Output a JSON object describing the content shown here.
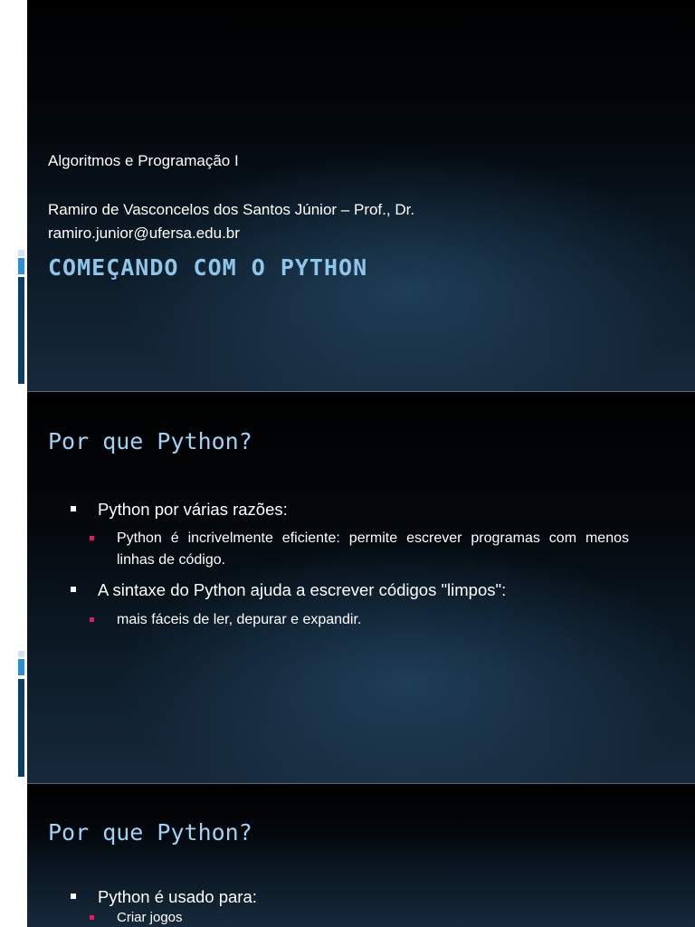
{
  "slide1": {
    "course": "Algoritmos e Programação I",
    "author": "Ramiro de Vasconcelos dos Santos Júnior – Prof., Dr.",
    "email": "ramiro.junior@ufersa.edu.br",
    "title": "COMEÇANDO COM O PYTHON"
  },
  "slide2": {
    "title": "Por que Python?",
    "bullets": [
      {
        "text": "Python por várias razões:",
        "sub": [
          "Python é incrivelmente eficiente: permite escrever programas com menos linhas de código."
        ]
      },
      {
        "text": "A sintaxe do Python ajuda a escrever códigos \"limpos\":",
        "sub": [
          "mais fáceis de ler, depurar e expandir."
        ]
      }
    ]
  },
  "slide3": {
    "title": "Por que Python?",
    "bullets": [
      {
        "text": "Python é usado para:",
        "sub": [
          "Criar jogos"
        ]
      }
    ]
  },
  "colors": {
    "title_blue": "#9fd2f4",
    "sub_bullet_pink": "#e0196a",
    "marker_blue": "#0d3e69"
  }
}
